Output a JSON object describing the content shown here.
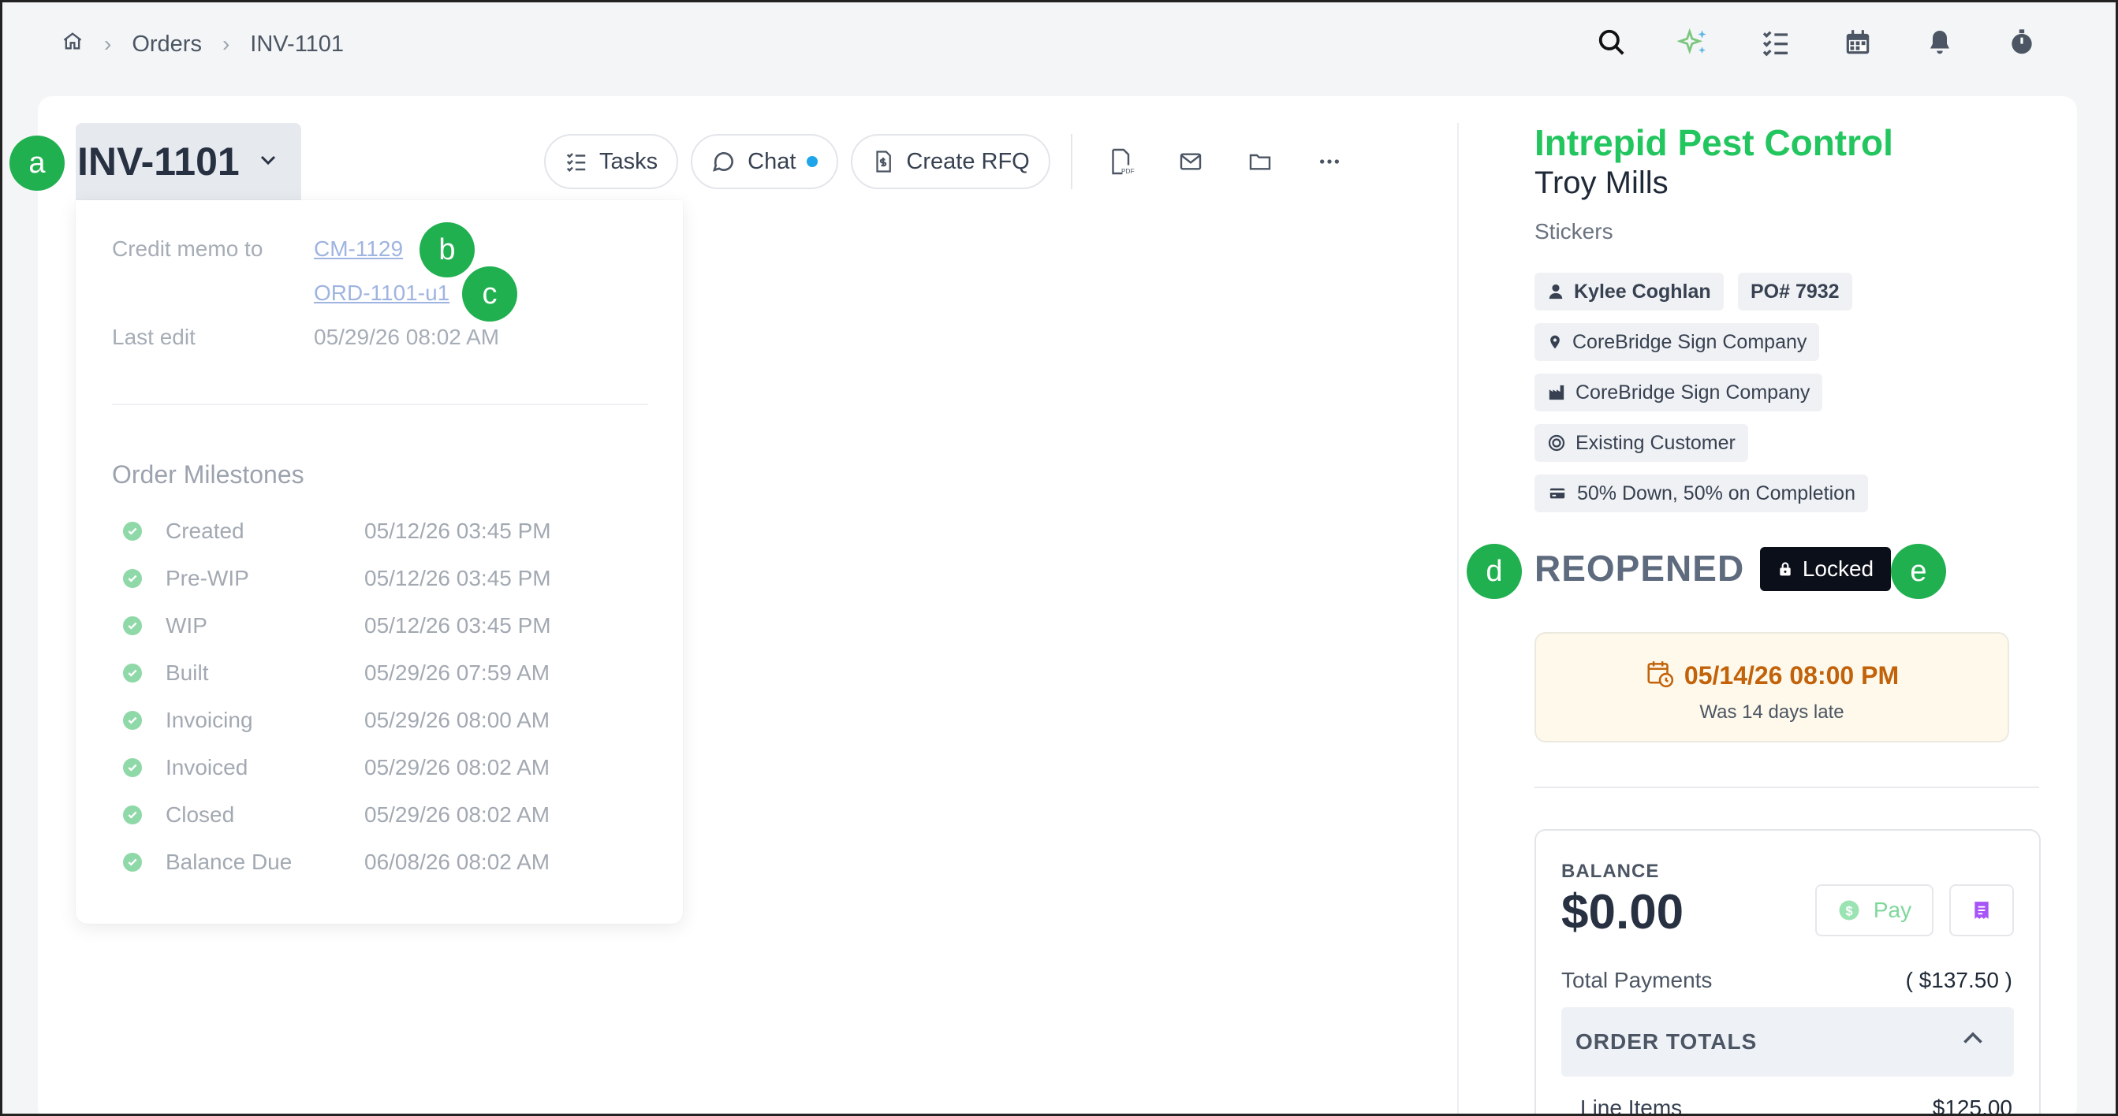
{
  "breadcrumb": {
    "home_icon": "home-icon",
    "items": [
      "Orders",
      "INV-1101"
    ]
  },
  "top_icons": [
    "search-icon",
    "sparkle-icon",
    "checklist-icon",
    "calendar-icon",
    "bell-icon",
    "stopwatch-icon"
  ],
  "order": {
    "id": "INV-1101"
  },
  "toolbar": {
    "tasks_label": "Tasks",
    "chat_label": "Chat",
    "rfq_label": "Create RFQ",
    "icons": [
      "pdf-icon",
      "mail-icon",
      "folder-icon",
      "more-icon"
    ]
  },
  "details": {
    "credit_memo_label": "Credit memo to",
    "credit_memo_link": "CM-1129",
    "order_link": "ORD-1101-u1",
    "last_edit_label": "Last edit",
    "last_edit_value": "05/29/26 08:02 AM"
  },
  "milestones": {
    "title": "Order Milestones",
    "items": [
      {
        "name": "Created",
        "date": "05/12/26 03:45 PM"
      },
      {
        "name": "Pre-WIP",
        "date": "05/12/26 03:45 PM"
      },
      {
        "name": "WIP",
        "date": "05/12/26 03:45 PM"
      },
      {
        "name": "Built",
        "date": "05/29/26 07:59 AM"
      },
      {
        "name": "Invoicing",
        "date": "05/29/26 08:00 AM"
      },
      {
        "name": "Invoiced",
        "date": "05/29/26 08:02 AM"
      },
      {
        "name": "Closed",
        "date": "05/29/26 08:02 AM"
      },
      {
        "name": "Balance Due",
        "date": "06/08/26 08:02 AM"
      }
    ]
  },
  "callouts": [
    "a",
    "b",
    "c",
    "d",
    "e"
  ],
  "customer": {
    "company": "Intrepid Pest Control",
    "contact": "Troy Mills",
    "category": "Stickers",
    "salesperson": "Kylee Coghlan",
    "po": "PO# 7932",
    "location": "CoreBridge Sign Company",
    "facility": "CoreBridge Sign Company",
    "customer_type": "Existing Customer",
    "payment_terms": "50% Down, 50% on Completion"
  },
  "status": {
    "label": "REOPENED",
    "lock_label": "Locked"
  },
  "due": {
    "date": "05/14/26 08:00 PM",
    "note": "Was 14 days late"
  },
  "balance": {
    "label": "BALANCE",
    "amount": "$0.00",
    "pay_label": "Pay",
    "total_payments_label": "Total Payments",
    "total_payments_value": "( $137.50 )",
    "order_totals_label": "ORDER TOTALS",
    "line_items_label": "Line Items",
    "line_items_value": "$125.00"
  },
  "colors": {
    "accent_green": "#22c55e",
    "callout": "#20b04f",
    "due_text": "#c2620a",
    "locked_bg": "#0b0f1a"
  }
}
